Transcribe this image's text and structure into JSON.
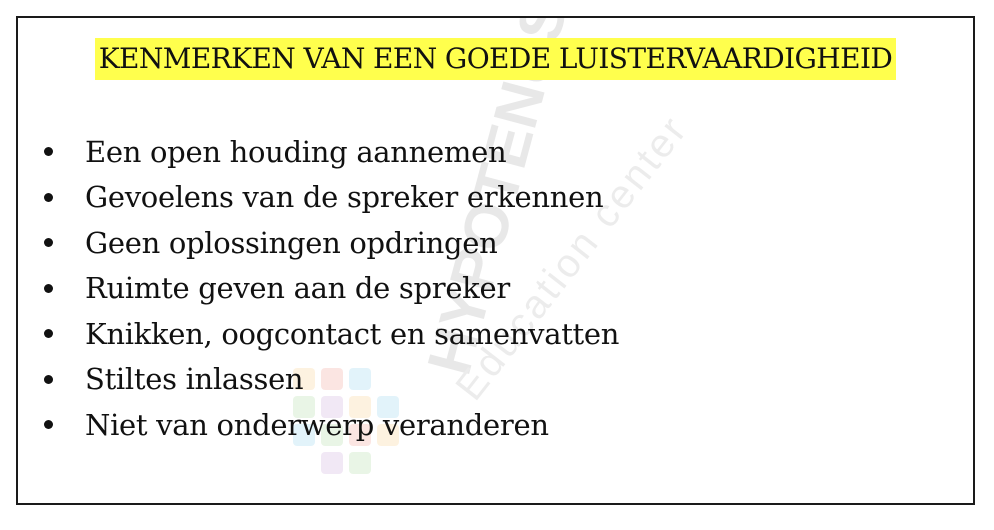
{
  "slide": {
    "title": "KENMERKEN VAN EEN GOEDE LUISTERVAARDIGHEID",
    "highlight_color": "#ffff4d",
    "bullets": [
      "Een open houding aannemen",
      "Gevoelens van de spreker erkennen",
      "Geen oplossingen opdringen",
      "Ruimte geven aan de spreker",
      "Knikken, oogcontact en samenvatten",
      "Stiltes inlassen",
      "Niet van onderwerp veranderen"
    ]
  },
  "watermark": {
    "brand": "HYPOTENUSE",
    "tagline": "Education center"
  }
}
